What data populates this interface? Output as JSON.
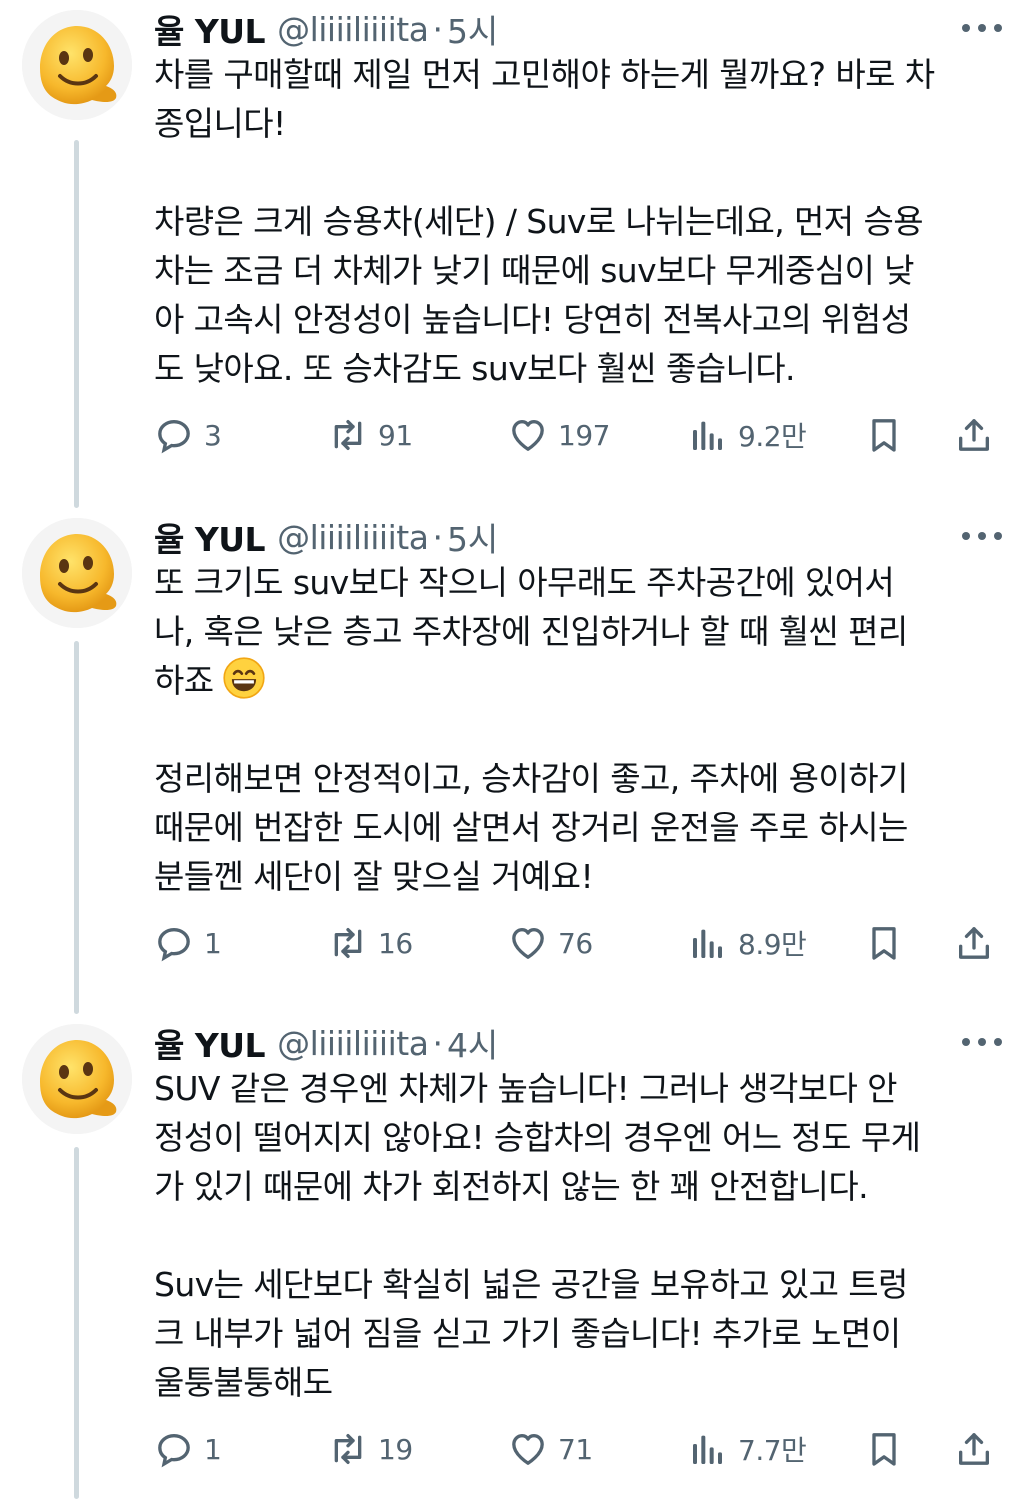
{
  "tweets": [
    {
      "name": "율 YUL",
      "handle": "@liiiiliiiita",
      "time": "5시",
      "lines": [
        "차를 구매할때 제일 먼저 고민해야 하는게 뭘까요? 바로 차",
        "종입니다!",
        "",
        "차량은 크게 승용차(세단) / Suv로 나뉘는데요, 먼저 승용",
        "차는 조금 더 차체가 낮기 때문에 suv보다 무게중심이 낮",
        "아 고속시 안정성이 높습니다! 당연히 전복사고의 위험성",
        "도 낮아요. 또 승차감도 suv보다 훨씬 좋습니다."
      ],
      "replies": "3",
      "retweets": "91",
      "likes": "197",
      "views": "9.2만"
    },
    {
      "name": "율 YUL",
      "handle": "@liiiiliiiita",
      "time": "5시",
      "lines": [
        "또 크기도 suv보다 작으니 아무래도 주차공간에 있어서",
        "나, 혹은 낮은 층고 주차장에 진입하거나 할 때 훨씬 편리",
        "하죠",
        "",
        "정리해보면 안정적이고, 승차감이 좋고, 주차에 용이하기",
        "때문에 번잡한 도시에 살면서 장거리 운전을 주로 하시는",
        "분들껜 세단이 잘 맞으실 거예요!"
      ],
      "replies": "1",
      "retweets": "16",
      "likes": "76",
      "views": "8.9만"
    },
    {
      "name": "율 YUL",
      "handle": "@liiiiliiiita",
      "time": "4시",
      "lines": [
        "SUV 같은 경우엔 차체가 높습니다! 그러나 생각보다 안",
        "정성이 떨어지지 않아요! 승합차의 경우엔 어느 정도 무게",
        "가 있기 때문에 차가 회전하지 않는 한 꽤 안전합니다.",
        "",
        "Suv는 세단보다 확실히 넓은 공간을 보유하고 있고 트렁",
        "크 내부가 넓어 짐을 싣고 가기 좋습니다! 추가로 노면이",
        "울퉁불퉁해도"
      ],
      "replies": "1",
      "retweets": "19",
      "likes": "71",
      "views": "7.7만"
    }
  ],
  "meta": {
    "dot": "·",
    "icons": {
      "reply": "reply-icon",
      "retweet": "retweet-icon",
      "like": "heart-icon",
      "views": "views-chart-icon",
      "bookmark": "bookmark-icon",
      "share": "share-icon",
      "more": "more-options-icon",
      "emoji": "grinning-face-emoji"
    },
    "colors": {
      "text": "#0f1419",
      "secondary": "#536471",
      "thread_line": "#cfd9de"
    }
  }
}
